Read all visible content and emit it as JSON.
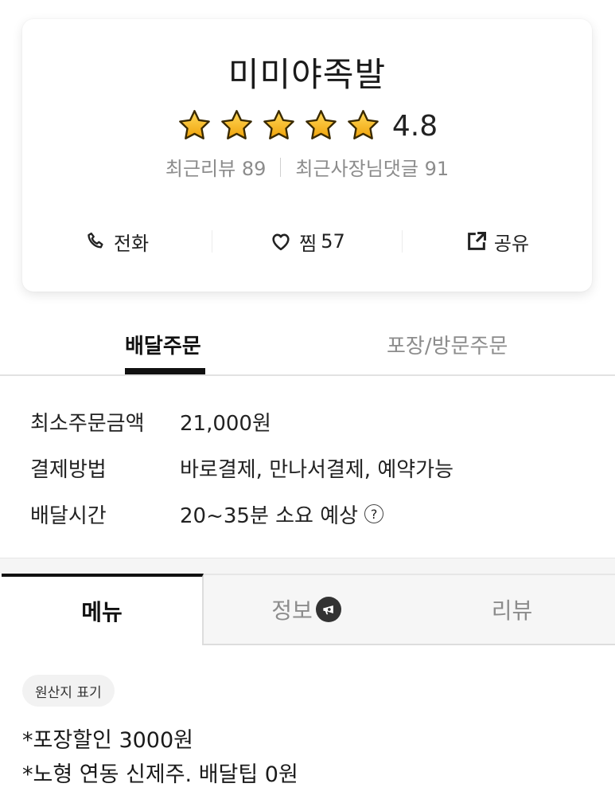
{
  "store": {
    "name": "미미야족발",
    "rating": "4.8",
    "stars_filled": 5,
    "stars_total": 5,
    "recent_reviews": "최근리뷰 89",
    "recent_owner_replies": "최근사장님댓글 91"
  },
  "actions": {
    "call_label": "전화",
    "like_label": "찜",
    "like_count": "57",
    "share_label": "공유"
  },
  "order_tabs": {
    "delivery": "배달주문",
    "pickup": "포장/방문주문"
  },
  "info": {
    "min_order_label": "최소주문금액",
    "min_order_value": "21,000원",
    "payment_label": "결제방법",
    "payment_value": "바로결제, 만나서결제, 예약가능",
    "delivery_time_label": "배달시간",
    "delivery_time_value": "20~35분 소요 예상"
  },
  "main_tabs": {
    "menu": "메뉴",
    "info": "정보",
    "review": "리뷰"
  },
  "origin_chip": "원산지 표기",
  "notices": [
    "*포장할인 3000원",
    "*노형 연동 신제주. 배달팁 0원"
  ],
  "colors": {
    "star": "#f6b51e",
    "text_primary": "#222222",
    "text_muted": "#8c8c8c",
    "tab_active": "#111111"
  },
  "icons": {
    "call": "phone-icon",
    "like": "heart-icon",
    "share": "share-icon",
    "help": "question-circle-icon",
    "info_badge": "megaphone-icon"
  }
}
